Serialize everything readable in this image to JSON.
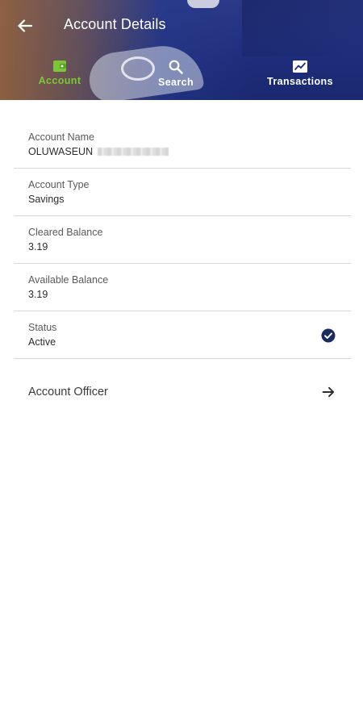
{
  "header": {
    "title": "Account Details",
    "back_icon": "arrow-left-icon"
  },
  "tabs": [
    {
      "label": "Account",
      "icon": "wallet-icon",
      "active": true,
      "color": "#7cc63a"
    },
    {
      "label": "Search",
      "icon": "search-icon",
      "active": false,
      "color": "#ffffff"
    },
    {
      "label": "Transactions",
      "icon": "chart-icon",
      "active": false,
      "color": "#ffffff"
    }
  ],
  "details": {
    "account_name": {
      "label": "Account Name",
      "value": "OLUWASEUN"
    },
    "account_type": {
      "label": "Account Type",
      "value": "Savings"
    },
    "cleared_balance": {
      "label": "Cleared Balance",
      "value": "3.19"
    },
    "available_balance": {
      "label": "Available Balance",
      "value": "3.19"
    },
    "status": {
      "label": "Status",
      "value": "Active",
      "icon": "check-circle-icon"
    }
  },
  "officer": {
    "label": "Account Officer",
    "icon": "arrow-right-icon"
  },
  "colors": {
    "header_bg": "#1f2f7c",
    "accent": "#7cc63a",
    "status_check": "#1c2a5e"
  }
}
